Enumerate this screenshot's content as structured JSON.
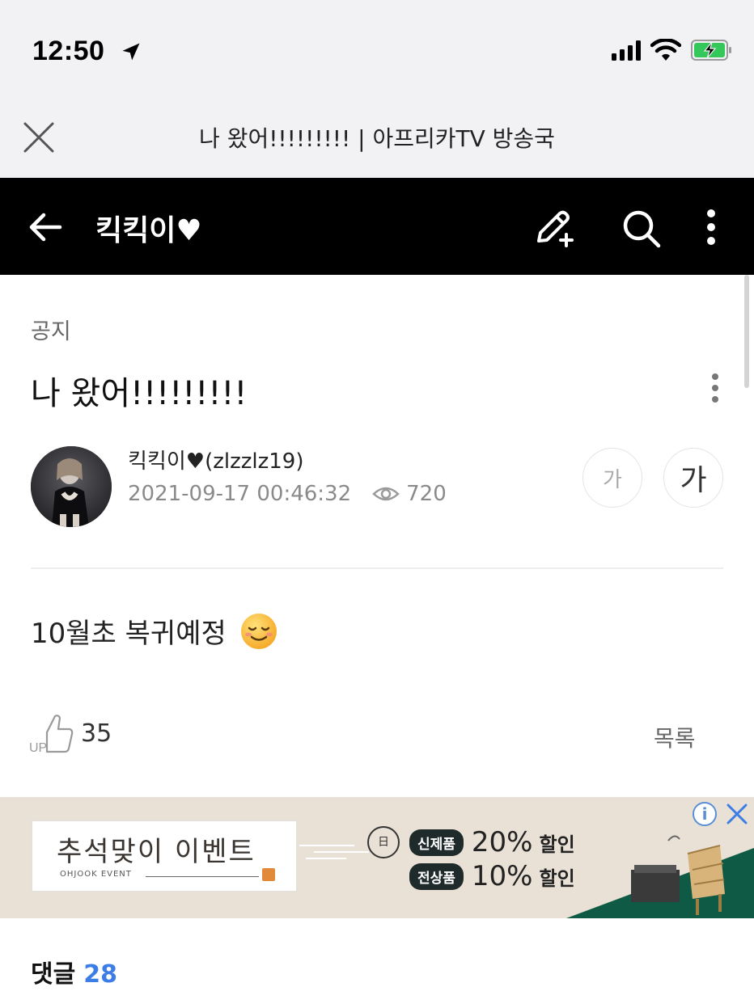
{
  "status_bar": {
    "time": "12:50"
  },
  "browser": {
    "page_title": "나 왔어!!!!!!!!! | 아프리카TV 방송국"
  },
  "header": {
    "blog_name": "킥킥이♥"
  },
  "post": {
    "category": "공지",
    "title": "나 왔어!!!!!!!!!",
    "author": "킥킥이♥(zlzzlz19)",
    "date": "2021-09-17 00:46:32",
    "views": "720",
    "font_small_label": "가",
    "font_large_label": "가",
    "body": "10월초 복귀예정",
    "like_badge": "UP",
    "likes": "35",
    "list_label": "목록"
  },
  "ad": {
    "headline": "추석맞이 이벤트",
    "subline": "OHJOOK EVENT",
    "logo_text": "日",
    "new_label": "신제품",
    "new_discount": "20%",
    "new_discount_text": "할인",
    "all_label": "전상품",
    "all_discount": "10%",
    "all_discount_text": "할인",
    "info_label": "i"
  },
  "comments": {
    "label": "댓글",
    "count": "28"
  },
  "colors": {
    "header_bg": "#000000",
    "topbar_bg": "#f2f2f4",
    "accent": "#3c7ee6",
    "battery_green": "#34c759",
    "ad_bg": "#eae1d6",
    "ad_green": "#0e5a45"
  }
}
